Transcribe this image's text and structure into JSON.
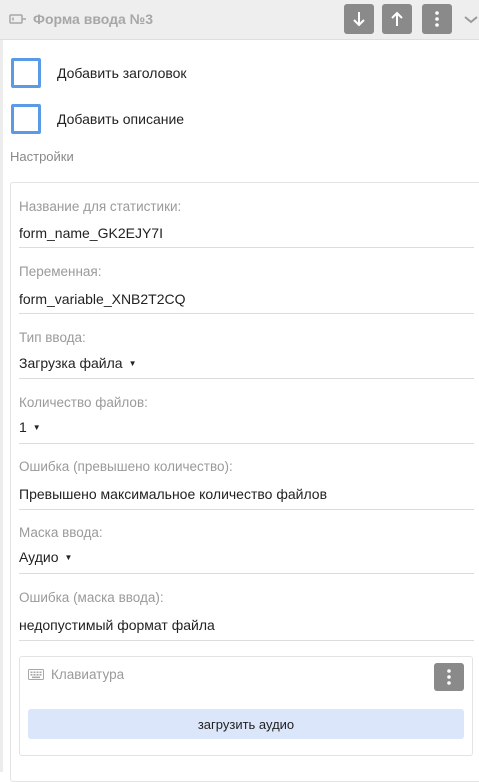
{
  "header": {
    "title": "Форма ввода  №3",
    "icons": {
      "form": "form-input-icon",
      "down": "arrow-down-icon",
      "up": "arrow-up-icon",
      "more": "more-vertical-icon",
      "collapse": "chevron-down-icon"
    }
  },
  "options": {
    "add_title": "Добавить заголовок",
    "add_description": "Добавить описание"
  },
  "settings": {
    "section_title": "Настройки",
    "fields": [
      {
        "label": "Название для статистики:",
        "value": "form_name_GK2EJY7I"
      },
      {
        "label": "Переменная:",
        "value": "form_variable_XNB2T2CQ"
      },
      {
        "label": "Тип ввода:",
        "value": "Загрузка файла"
      },
      {
        "label": "Количество файлов:",
        "value": "1"
      },
      {
        "label": "Ошибка (превышено количество):",
        "value": "Превышено максимальное количество файлов"
      },
      {
        "label": "Маска ввода:",
        "value": "Аудио"
      },
      {
        "label": "Ошибка (маска ввода):",
        "value": "недопустимый формат файла"
      }
    ]
  },
  "keyboard": {
    "title": "Клавиатура",
    "icon": "keyboard-icon",
    "button_label": "загрузить аудио"
  },
  "colors": {
    "accent": "#5b9be6",
    "button_gray": "#8a8a8a",
    "upload_bg": "#dbe6fb"
  }
}
